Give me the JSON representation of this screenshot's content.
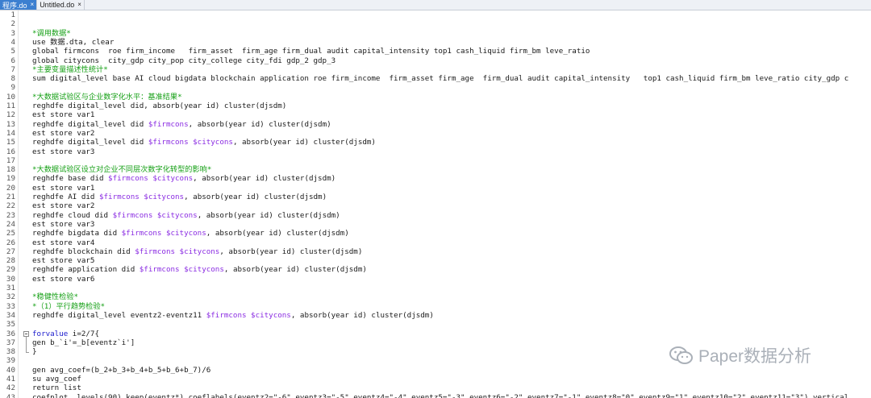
{
  "tabs": [
    {
      "label": "程序.do",
      "close": "×",
      "active": true
    },
    {
      "label": "Untitled.do",
      "close": "×",
      "active": false
    }
  ],
  "lines": [
    {
      "n": "1",
      "segs": []
    },
    {
      "n": "2",
      "segs": []
    },
    {
      "n": "3",
      "segs": [
        {
          "t": "*调用数据*",
          "c": "cm"
        }
      ]
    },
    {
      "n": "4",
      "segs": [
        {
          "t": "use 数据.dta, clear",
          "c": ""
        }
      ]
    },
    {
      "n": "5",
      "segs": [
        {
          "t": "global firmcons  roe firm_income   firm_asset  firm_age firm_dual audit capital_intensity top1 cash_liquid firm_bm leve_ratio",
          "c": ""
        }
      ]
    },
    {
      "n": "6",
      "segs": [
        {
          "t": "global citycons  city_gdp city_pop city_college city_fdi gdp_2 gdp_3",
          "c": ""
        }
      ]
    },
    {
      "n": "7",
      "segs": [
        {
          "t": "*主要变量描述性统计*",
          "c": "cm"
        }
      ]
    },
    {
      "n": "8",
      "segs": [
        {
          "t": "sum digital_level base AI cloud bigdata blockchain application roe firm_income  firm_asset firm_age  firm_dual audit capital_intensity   top1 cash_liquid firm_bm leve_ratio city_gdp c",
          "c": ""
        }
      ]
    },
    {
      "n": "9",
      "segs": []
    },
    {
      "n": "10",
      "segs": [
        {
          "t": "*大数据试验区与企业数字化水平：基准结果*",
          "c": "cm"
        }
      ]
    },
    {
      "n": "11",
      "segs": [
        {
          "t": "reghdfe digital_level did, absorb(year id) cluster(djsdm)",
          "c": ""
        }
      ]
    },
    {
      "n": "12",
      "segs": [
        {
          "t": "est store var1",
          "c": ""
        }
      ]
    },
    {
      "n": "13",
      "segs": [
        {
          "t": "reghdfe digital_level did ",
          "c": ""
        },
        {
          "t": "$firmcons",
          "c": "mac"
        },
        {
          "t": ", absorb(year id) cluster(djsdm)",
          "c": ""
        }
      ]
    },
    {
      "n": "14",
      "segs": [
        {
          "t": "est store var2",
          "c": ""
        }
      ]
    },
    {
      "n": "15",
      "segs": [
        {
          "t": "reghdfe digital_level did ",
          "c": ""
        },
        {
          "t": "$firmcons $citycons",
          "c": "mac"
        },
        {
          "t": ", absorb(year id) cluster(djsdm)",
          "c": ""
        }
      ]
    },
    {
      "n": "16",
      "segs": [
        {
          "t": "est store var3",
          "c": ""
        }
      ]
    },
    {
      "n": "17",
      "segs": []
    },
    {
      "n": "18",
      "segs": [
        {
          "t": "*大数据试验区设立对企业不同层次数字化转型的影响*",
          "c": "cm"
        }
      ]
    },
    {
      "n": "19",
      "segs": [
        {
          "t": "reghdfe base did ",
          "c": ""
        },
        {
          "t": "$firmcons $citycons",
          "c": "mac"
        },
        {
          "t": ", absorb(year id) cluster(djsdm)",
          "c": ""
        }
      ]
    },
    {
      "n": "20",
      "segs": [
        {
          "t": "est store var1",
          "c": ""
        }
      ]
    },
    {
      "n": "21",
      "segs": [
        {
          "t": "reghdfe AI did ",
          "c": ""
        },
        {
          "t": "$firmcons $citycons",
          "c": "mac"
        },
        {
          "t": ", absorb(year id) cluster(djsdm)",
          "c": ""
        }
      ]
    },
    {
      "n": "22",
      "segs": [
        {
          "t": "est store var2",
          "c": ""
        }
      ]
    },
    {
      "n": "23",
      "segs": [
        {
          "t": "reghdfe cloud did ",
          "c": ""
        },
        {
          "t": "$firmcons $citycons",
          "c": "mac"
        },
        {
          "t": ", absorb(year id) cluster(djsdm)",
          "c": ""
        }
      ]
    },
    {
      "n": "24",
      "segs": [
        {
          "t": "est store var3",
          "c": ""
        }
      ]
    },
    {
      "n": "25",
      "segs": [
        {
          "t": "reghdfe bigdata did ",
          "c": ""
        },
        {
          "t": "$firmcons $citycons",
          "c": "mac"
        },
        {
          "t": ", absorb(year id) cluster(djsdm)",
          "c": ""
        }
      ]
    },
    {
      "n": "26",
      "segs": [
        {
          "t": "est store var4",
          "c": ""
        }
      ]
    },
    {
      "n": "27",
      "segs": [
        {
          "t": "reghdfe blockchain did ",
          "c": ""
        },
        {
          "t": "$firmcons $citycons",
          "c": "mac"
        },
        {
          "t": ", absorb(year id) cluster(djsdm)",
          "c": ""
        }
      ]
    },
    {
      "n": "28",
      "segs": [
        {
          "t": "est store var5",
          "c": ""
        }
      ]
    },
    {
      "n": "29",
      "segs": [
        {
          "t": "reghdfe application did ",
          "c": ""
        },
        {
          "t": "$firmcons $citycons",
          "c": "mac"
        },
        {
          "t": ", absorb(year id) cluster(djsdm)",
          "c": ""
        }
      ]
    },
    {
      "n": "30",
      "segs": [
        {
          "t": "est store var6",
          "c": ""
        }
      ]
    },
    {
      "n": "31",
      "segs": []
    },
    {
      "n": "32",
      "segs": [
        {
          "t": "*稳健性检验*",
          "c": "cm"
        }
      ]
    },
    {
      "n": "33",
      "segs": [
        {
          "t": "*（1）平行趋势检验*",
          "c": "cm"
        }
      ]
    },
    {
      "n": "34",
      "segs": [
        {
          "t": "reghdfe digital_level eventz2-eventz11 ",
          "c": ""
        },
        {
          "t": "$firmcons $citycons",
          "c": "mac"
        },
        {
          "t": ", absorb(year id) cluster(djsdm)",
          "c": ""
        }
      ]
    },
    {
      "n": "35",
      "segs": []
    },
    {
      "n": "36",
      "segs": [
        {
          "t": "forvalue",
          "c": "kw"
        },
        {
          "t": " i=2/7{",
          "c": ""
        }
      ]
    },
    {
      "n": "37",
      "segs": [
        {
          "t": "gen b_`i'=_b[eventz`i']",
          "c": ""
        }
      ]
    },
    {
      "n": "38",
      "segs": [
        {
          "t": "}",
          "c": ""
        }
      ]
    },
    {
      "n": "39",
      "segs": []
    },
    {
      "n": "40",
      "segs": [
        {
          "t": "gen avg_coef=(b_2+b_3+b_4+b_5+b_6+b_7)/6",
          "c": ""
        }
      ]
    },
    {
      "n": "41",
      "segs": [
        {
          "t": "su avg_coef",
          "c": ""
        }
      ]
    },
    {
      "n": "42",
      "segs": [
        {
          "t": "return list",
          "c": ""
        }
      ]
    },
    {
      "n": "43",
      "segs": [
        {
          "t": "coefplot, levels(90) keep(eventz*) coeflabels(eventz2=\"-6\" eventz3=\"-5\" eventz4=\"-4\" eventz5=\"-3\" eventz6=\"-2\" eventz7=\"-1\" eventz8=\"0\" eventz9=\"1\" eventz10=\"2\" eventz11=\"3\") vertical",
          "c": ""
        }
      ]
    }
  ],
  "watermark": {
    "text": "Paper数据分析",
    "icon": "wechat-icon"
  },
  "colors": {
    "comment": "#16a016",
    "keyword": "#1a1acc",
    "macro": "#8a2be2",
    "active_tab": "#3c7fd0"
  }
}
